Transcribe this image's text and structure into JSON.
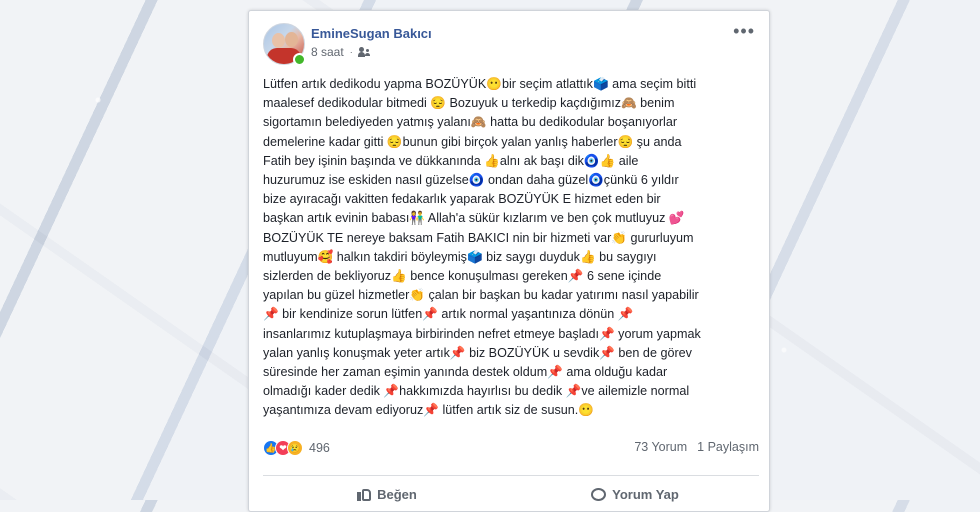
{
  "post": {
    "author": "EmineSugan Bakıcı",
    "time": "8 saat",
    "privacy_icon": "group-icon",
    "more_label": "•••",
    "lines": [
      "Lütfen artık dedikodu yapma BOZÜYÜK😶bir seçim atlattık🗳️ ama seçim bitti",
      "maalesef dedikodular bitmedi 😔 Bozuyuk u terkedip kaçdığımız🙈 benim",
      "sigortamın belediyeden yatmış yalanı🙈 hatta bu dedikodular boşanıyorlar",
      "demelerine kadar gitti 😔bunun gibi birçok yalan yanlış haberler😔 şu anda",
      "Fatih bey işinin başında ve dükkanında 👍alnı ak başı dik🧿👍 aile",
      "huzurumuz ise eskiden nasıl güzelse🧿 ondan daha güzel🧿çünkü 6 yıldır",
      "bize ayıracağı vakitten fedakarlık yaparak BOZÜYÜK E hizmet eden bir",
      "başkan artık evinin babası👫 Allah'a sükür kızlarım ve ben çok mutluyuz 💕",
      "BOZÜYÜK TE nereye baksam Fatih BAKICI nin bir hizmeti var👏 gururluyum",
      "mutluyum🥰 halkın takdiri böyleymiş🗳️ biz saygı duyduk👍 bu saygıyı",
      "sizlerden de bekliyoruz👍 bence konuşulması gereken📌 6 sene içinde",
      "yapılan bu güzel hizmetler👏 çalan bir başkan bu kadar yatırımı nasıl yapabilir",
      "📌 bir kendinize sorun lütfen📌 artık normal yaşantınıza dönün 📌",
      "insanlarımız kutuplaşmaya birbirinden nefret etmeye başladı📌 yorum yapmak",
      "yalan yanlış konuşmak yeter artık📌 biz BOZÜYÜK u sevdik📌 ben de görev",
      "süresinde her zaman eşimin yanında destek oldum📌 ama olduğu kadar",
      "olmadığı kader dedik 📌hakkımızda hayırlısı bu dedik 📌ve ailemizle normal",
      "yaşantımıza devam ediyoruz📌 lütfen artık siz de susun.😶"
    ],
    "reactions": {
      "icons": [
        "like-icon",
        "love-icon",
        "sad-icon"
      ],
      "like_glyph": "👍",
      "love_glyph": "❤",
      "sad_glyph": "😢",
      "count": "496"
    },
    "comments": "73 Yorum",
    "shares": "1 Paylaşım",
    "actions": {
      "like": "Beğen",
      "comment": "Yorum Yap"
    }
  }
}
